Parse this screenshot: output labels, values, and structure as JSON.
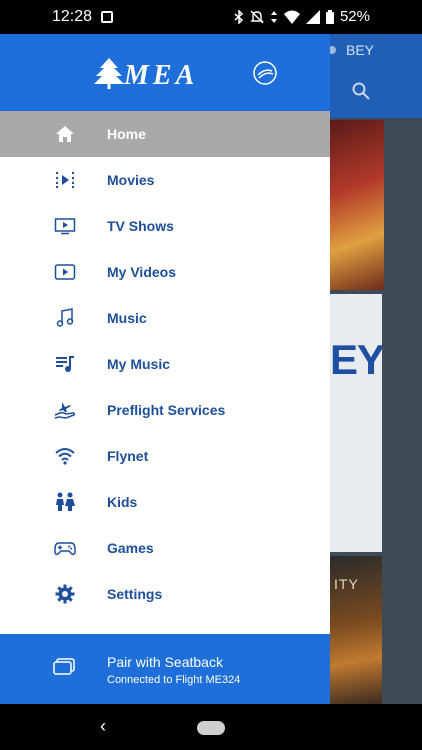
{
  "status_bar": {
    "time": "12:28",
    "battery": "52%"
  },
  "background": {
    "location": "BEY",
    "poster_text_1": "EY",
    "poster_text_2": "ITY"
  },
  "drawer": {
    "brand": "MEA",
    "menu": [
      {
        "label": "Home",
        "icon": "home-icon",
        "active": true
      },
      {
        "label": "Movies",
        "icon": "movies-icon"
      },
      {
        "label": "TV Shows",
        "icon": "tv-icon"
      },
      {
        "label": "My Videos",
        "icon": "play-icon"
      },
      {
        "label": "Music",
        "icon": "music-note-icon"
      },
      {
        "label": "My Music",
        "icon": "music-list-icon"
      },
      {
        "label": "Preflight Services",
        "icon": "plane-hand-icon"
      },
      {
        "label": "Flynet",
        "icon": "wifi-icon"
      },
      {
        "label": "Kids",
        "icon": "kids-icon"
      },
      {
        "label": "Games",
        "icon": "gamepad-icon"
      },
      {
        "label": "Settings",
        "icon": "gear-icon"
      }
    ],
    "footer": {
      "title": "Pair with Seatback",
      "subtitle": "Connected to Flight ME324"
    }
  },
  "colors": {
    "primary": "#1e6fd9",
    "label": "#1d4f9c",
    "active_bg": "#a9a9a9"
  }
}
